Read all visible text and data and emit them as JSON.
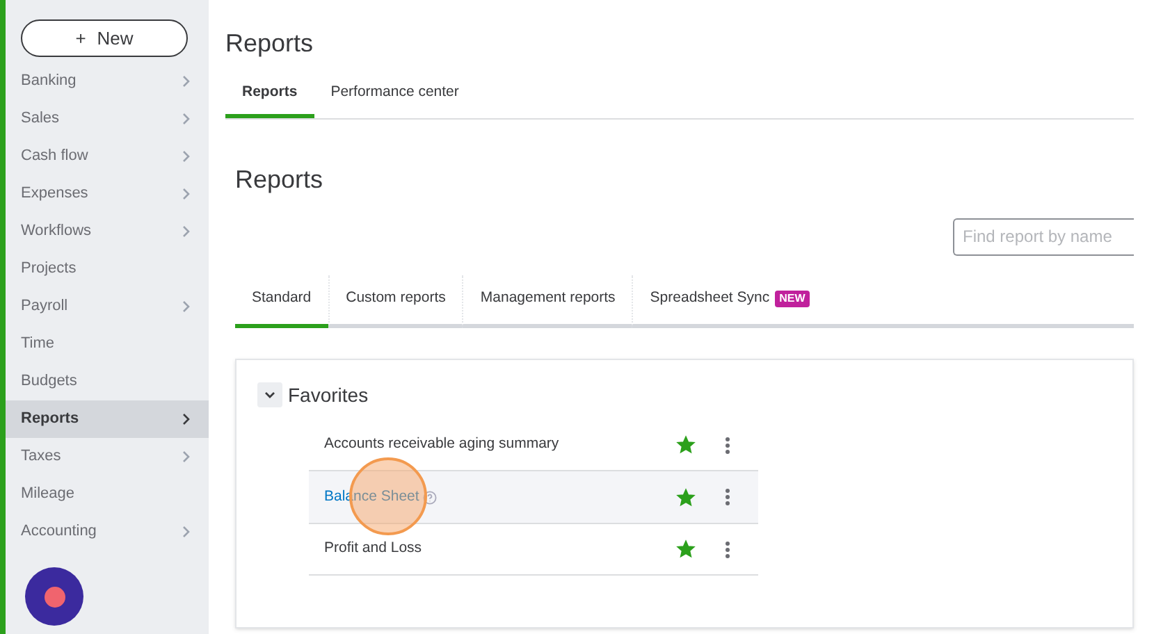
{
  "sidebar": {
    "new_button": "New",
    "new_icon": "+",
    "items": [
      {
        "label": "Banking",
        "selected": false,
        "has_submenu": true
      },
      {
        "label": "Sales",
        "selected": false,
        "has_submenu": true
      },
      {
        "label": "Cash flow",
        "selected": false,
        "has_submenu": true
      },
      {
        "label": "Expenses",
        "selected": false,
        "has_submenu": true
      },
      {
        "label": "Workflows",
        "selected": false,
        "has_submenu": true
      },
      {
        "label": "Projects",
        "selected": false,
        "has_submenu": false
      },
      {
        "label": "Payroll",
        "selected": false,
        "has_submenu": true
      },
      {
        "label": "Time",
        "selected": false,
        "has_submenu": false
      },
      {
        "label": "Budgets",
        "selected": false,
        "has_submenu": false
      },
      {
        "label": "Reports",
        "selected": true,
        "has_submenu": true
      },
      {
        "label": "Taxes",
        "selected": false,
        "has_submenu": true
      },
      {
        "label": "Mileage",
        "selected": false,
        "has_submenu": false
      },
      {
        "label": "Accounting",
        "selected": false,
        "has_submenu": true
      }
    ]
  },
  "page_title": "Reports",
  "tabs": [
    {
      "label": "Reports",
      "selected": true
    },
    {
      "label": "Performance center",
      "selected": false
    }
  ],
  "section_title": "Reports",
  "search": {
    "placeholder": "Find report by name"
  },
  "report_tabs": [
    {
      "label": "Standard",
      "selected": true
    },
    {
      "label": "Custom reports",
      "selected": false
    },
    {
      "label": "Management reports",
      "selected": false
    },
    {
      "label": "Spreadsheet Sync",
      "selected": false,
      "badge": "NEW"
    }
  ],
  "favorites": {
    "title": "Favorites",
    "expanded": true,
    "reports": [
      {
        "name": "Accounts receivable aging summary",
        "starred": true,
        "hovered": false
      },
      {
        "name": "Balance Sheet",
        "starred": true,
        "hovered": true
      },
      {
        "name": "Profit and Loss",
        "starred": true,
        "hovered": false
      }
    ]
  }
}
